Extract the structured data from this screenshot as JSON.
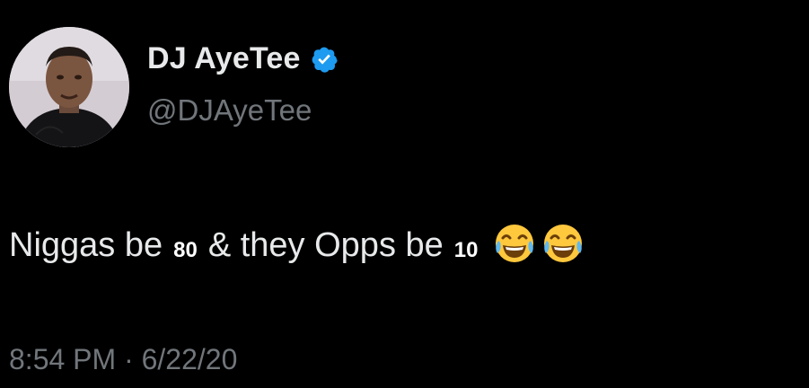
{
  "author": {
    "display_name": "DJ AyeTee",
    "handle": "@DJAyeTee",
    "verified": true
  },
  "tweet": {
    "part1": "Niggas be",
    "num1": "80",
    "part2": "& they Opps be",
    "num2": "10",
    "emojis": [
      "face-with-tears-of-joy-icon",
      "face-with-tears-of-joy-icon"
    ]
  },
  "timestamp": "8:54 PM · 6/22/20",
  "colors": {
    "background": "#000000",
    "text": "#e7e9ea",
    "muted": "#71767b",
    "verified": "#1d9bf0"
  }
}
